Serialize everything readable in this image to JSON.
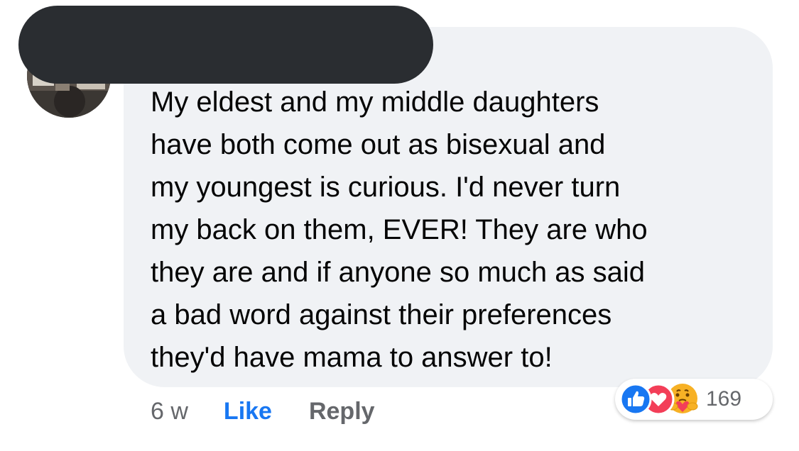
{
  "comment": {
    "text": "My eldest and my middle daughters\nhave both come out as bisexual and\nmy youngest is curious. I'd never turn\nmy back on them, EVER! They are who\nthey are and if anyone so much as said\na bad word against their preferences\nthey'd have mama to answer to!",
    "time": "6 w",
    "like_label": "Like",
    "reply_label": "Reply"
  },
  "reactions": {
    "icons": [
      "like-icon",
      "love-icon",
      "care-icon"
    ],
    "count": "169"
  },
  "colors": {
    "bubble": "#f0f2f5",
    "link_blue": "#1877f2",
    "meta_gray": "#65676b",
    "redaction": "#2a2d31"
  }
}
